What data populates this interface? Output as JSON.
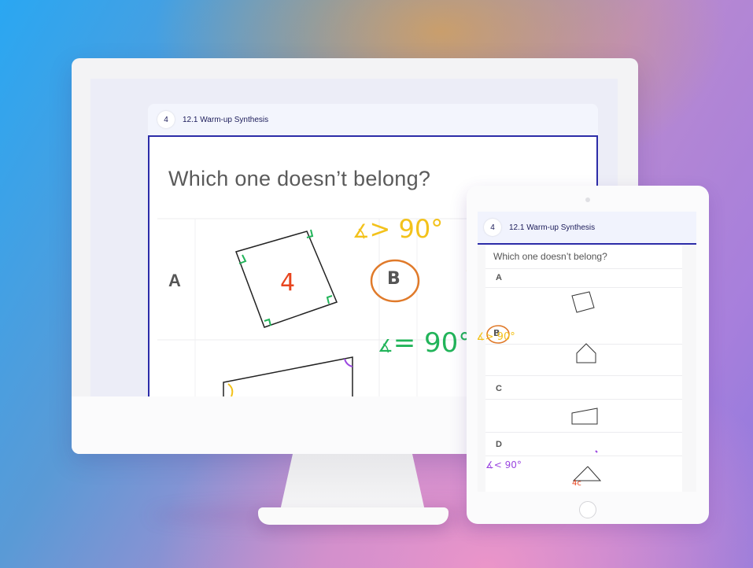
{
  "desktop": {
    "slide_number": "4",
    "slide_title": "12.1 Warm-up Synthesis",
    "question": "Which one doesn’t belong?",
    "row_labels": [
      "A"
    ],
    "annotations": {
      "square_side": "4",
      "gt_note": "> 90°",
      "circled": "B",
      "eq_note": "= 90°"
    }
  },
  "tablet": {
    "slide_number": "4",
    "slide_title": "12.1 Warm-up Synthesis",
    "question": "Which one doesn’t belong?",
    "labels": {
      "a": "A",
      "c": "C",
      "d": "D"
    },
    "annotations": {
      "gt_note": "> 90°",
      "circled": "B",
      "lt_note": "< 90°",
      "side_note": "4c"
    }
  },
  "colors": {
    "frame_border": "#2c2ca8",
    "yellow_ink": "#f3c21b",
    "orange_ink": "#e07a2a",
    "green_ink": "#22b45a",
    "purple_ink": "#9b47e0",
    "red_ink": "#e8451e"
  }
}
